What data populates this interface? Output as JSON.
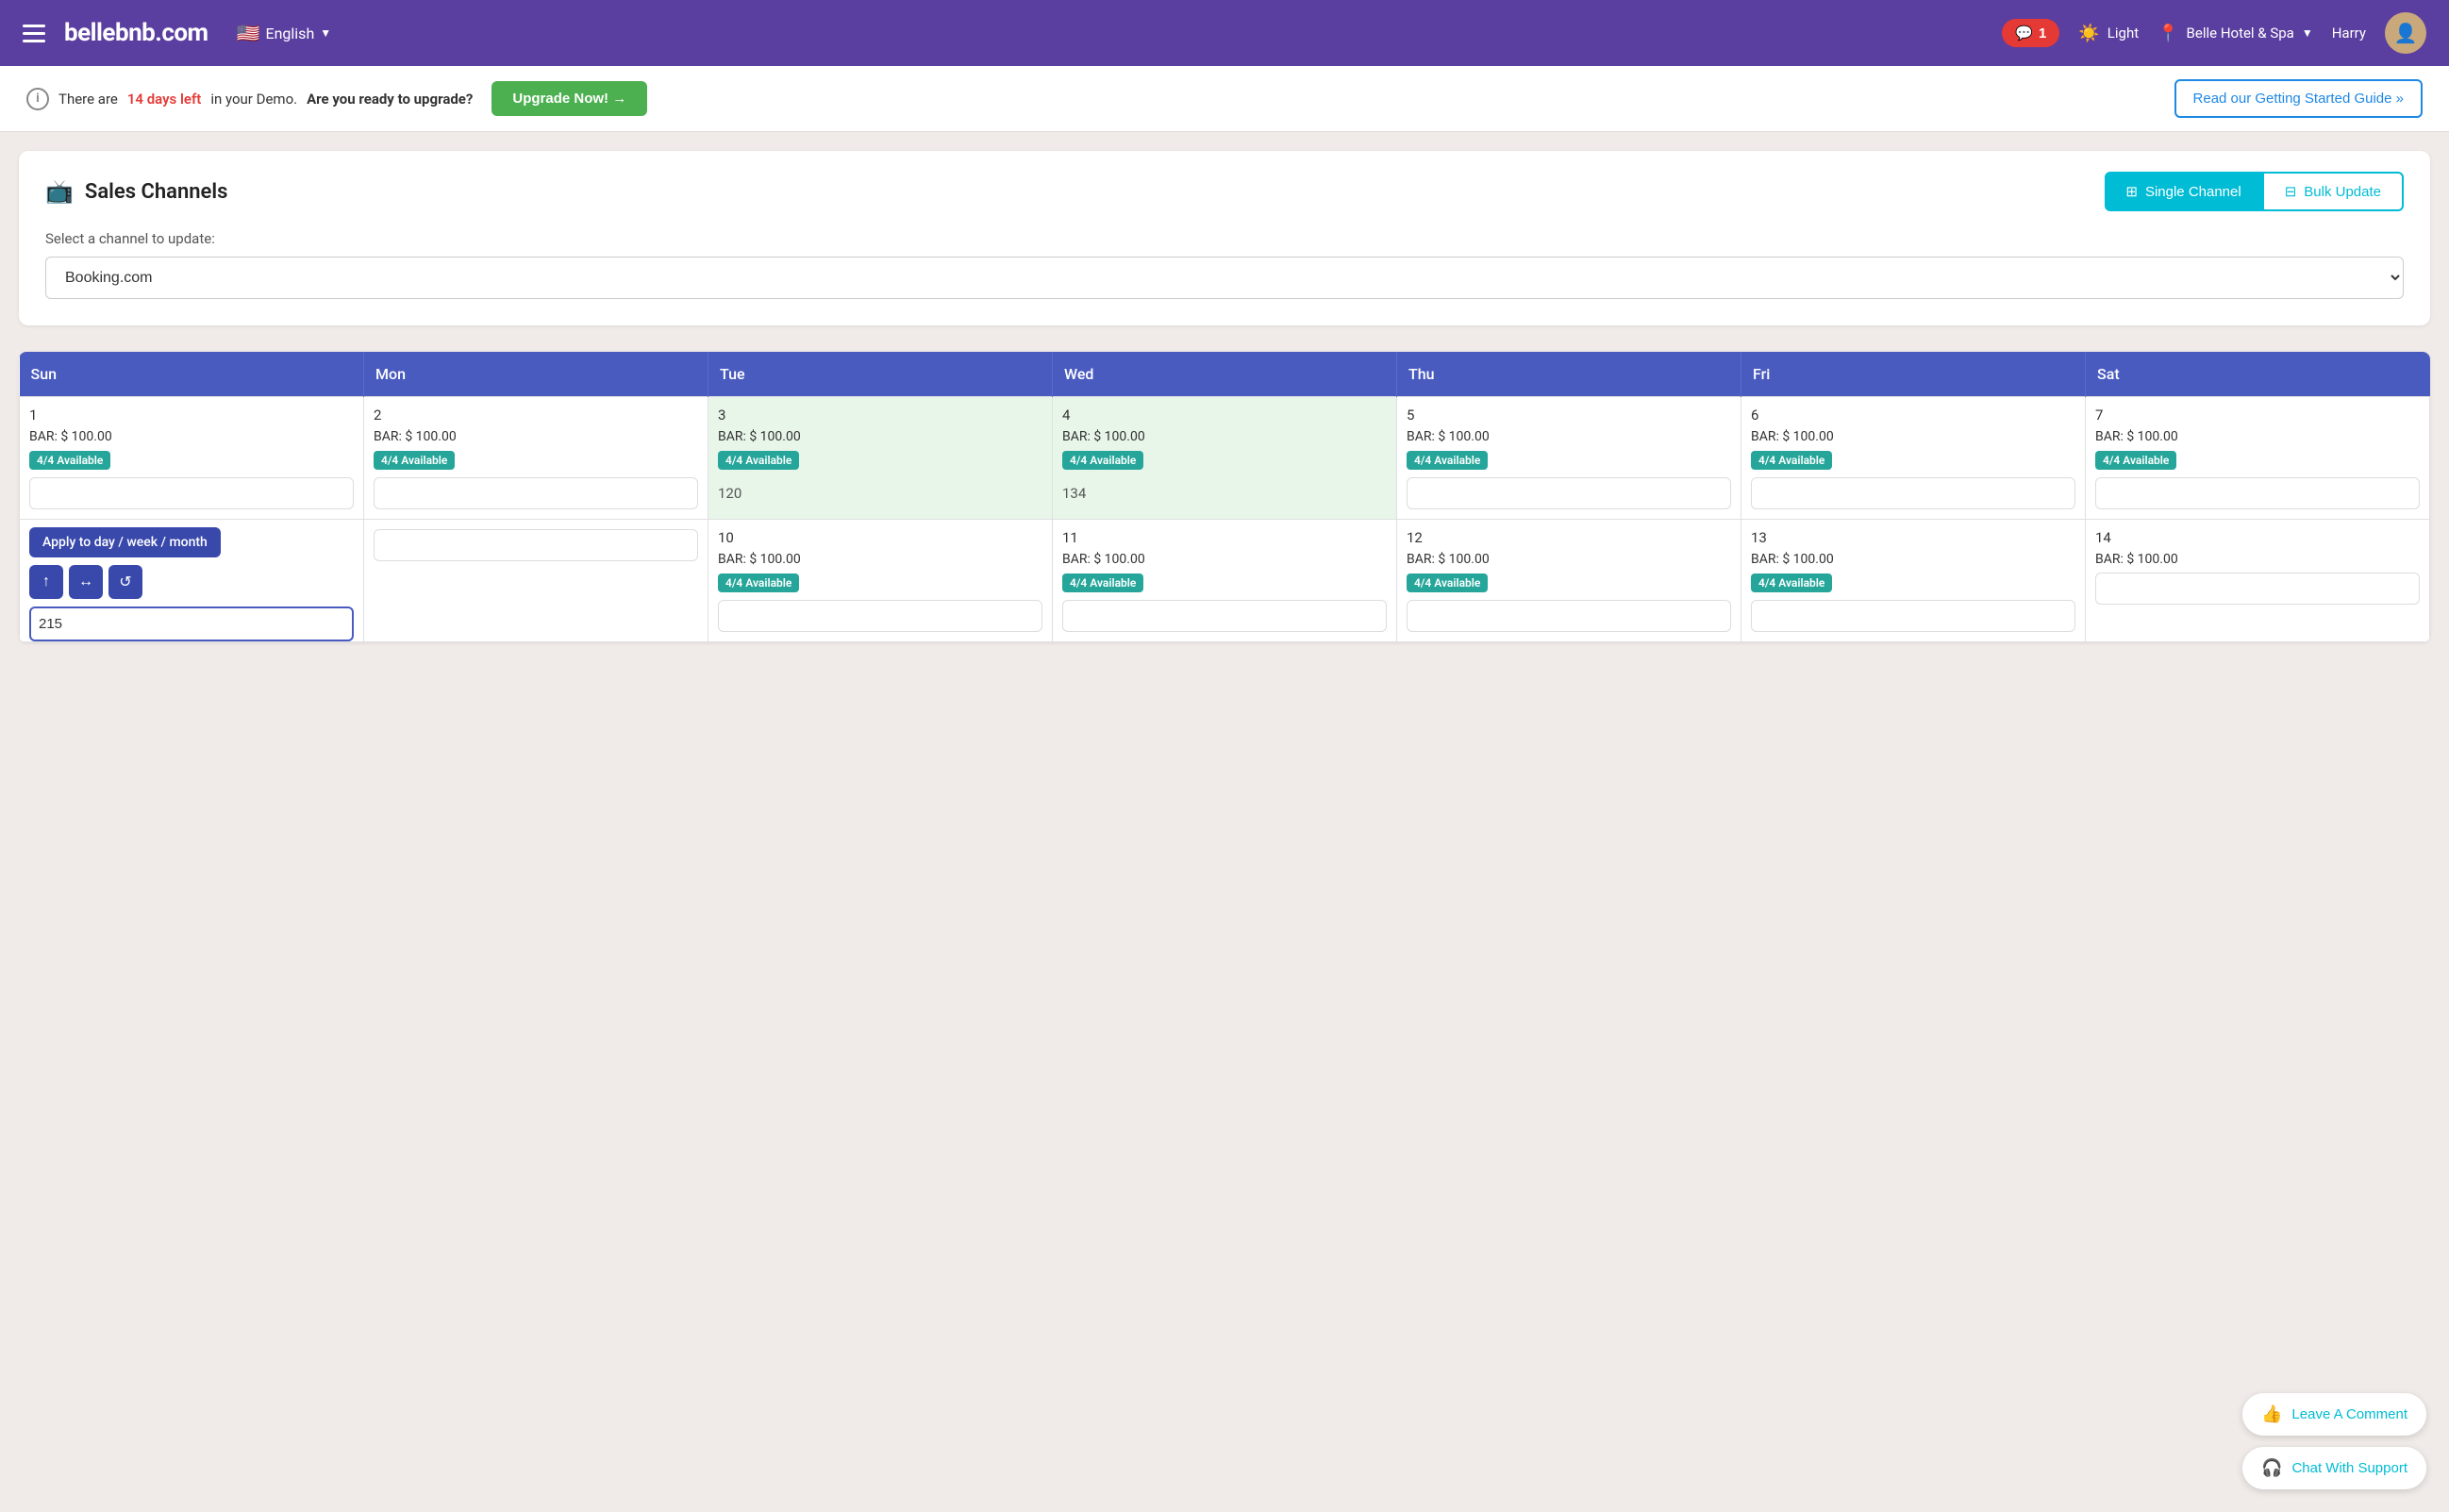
{
  "header": {
    "logo": "bellebnb.com",
    "lang": "English",
    "notif_count": "1",
    "theme": "Light",
    "hotel": "Belle Hotel & Spa",
    "user": "Harry"
  },
  "banner": {
    "info_text": "There are",
    "days_left": "14 days left",
    "info_text2": "in your Demo.",
    "bold_text": "Are you ready to upgrade?",
    "upgrade_label": "Upgrade Now! →",
    "guide_label": "Read our Getting Started Guide »"
  },
  "sales_channels": {
    "title": "Sales Channels",
    "channel_label": "Select a channel to update:",
    "channel_value": "Booking.com",
    "tab_single": "Single Channel",
    "tab_bulk": "Bulk Update"
  },
  "calendar": {
    "days": [
      "Sun",
      "Mon",
      "Tue",
      "Wed",
      "Thu",
      "Fri",
      "Sat"
    ],
    "row1": [
      {
        "date": "1",
        "bar": "BAR: $ 100.00",
        "avail": "4/4 Available",
        "input": "",
        "highlighted": false
      },
      {
        "date": "2",
        "bar": "BAR: $ 100.00",
        "avail": "4/4 Available",
        "input": "",
        "highlighted": false
      },
      {
        "date": "3",
        "bar": "BAR: $ 100.00",
        "avail": "4/4 Available",
        "input": "120",
        "highlighted": true
      },
      {
        "date": "4",
        "bar": "BAR: $ 100.00",
        "avail": "4/4 Available",
        "input": "134",
        "highlighted": true
      },
      {
        "date": "5",
        "bar": "BAR: $ 100.00",
        "avail": "4/4 Available",
        "input": "",
        "highlighted": false
      },
      {
        "date": "6",
        "bar": "BAR: $ 100.00",
        "avail": "4/4 Available",
        "input": "",
        "highlighted": false
      },
      {
        "date": "7",
        "bar": "BAR: $ 100.00",
        "avail": "4/4 Available",
        "input": "",
        "highlighted": false
      }
    ],
    "row2": [
      {
        "date": "",
        "bar": "",
        "avail": "",
        "input": "",
        "highlighted": false,
        "tooltip": true
      },
      {
        "date": "",
        "bar": "",
        "avail": "",
        "input": "",
        "highlighted": false
      },
      {
        "date": "10",
        "bar": "BAR: $ 100.00",
        "avail": "4/4 Available",
        "input": "",
        "highlighted": false
      },
      {
        "date": "11",
        "bar": "BAR: $ 100.00",
        "avail": "4/4 Available",
        "input": "",
        "highlighted": false
      },
      {
        "date": "12",
        "bar": "BAR: $ 100.00",
        "avail": "4/4 Available",
        "input": "",
        "highlighted": false
      },
      {
        "date": "13",
        "bar": "BAR: $ 100.00",
        "avail": "4/4 Available",
        "input": "",
        "highlighted": false
      },
      {
        "date": "14",
        "bar": "BAR: $ 100.00",
        "avail": "",
        "input": "",
        "highlighted": false
      }
    ],
    "tooltip": {
      "label": "Apply to day / week / month",
      "active_input": "215"
    }
  },
  "floating": {
    "comment_label": "Leave A Comment",
    "support_label": "Chat With Support"
  }
}
